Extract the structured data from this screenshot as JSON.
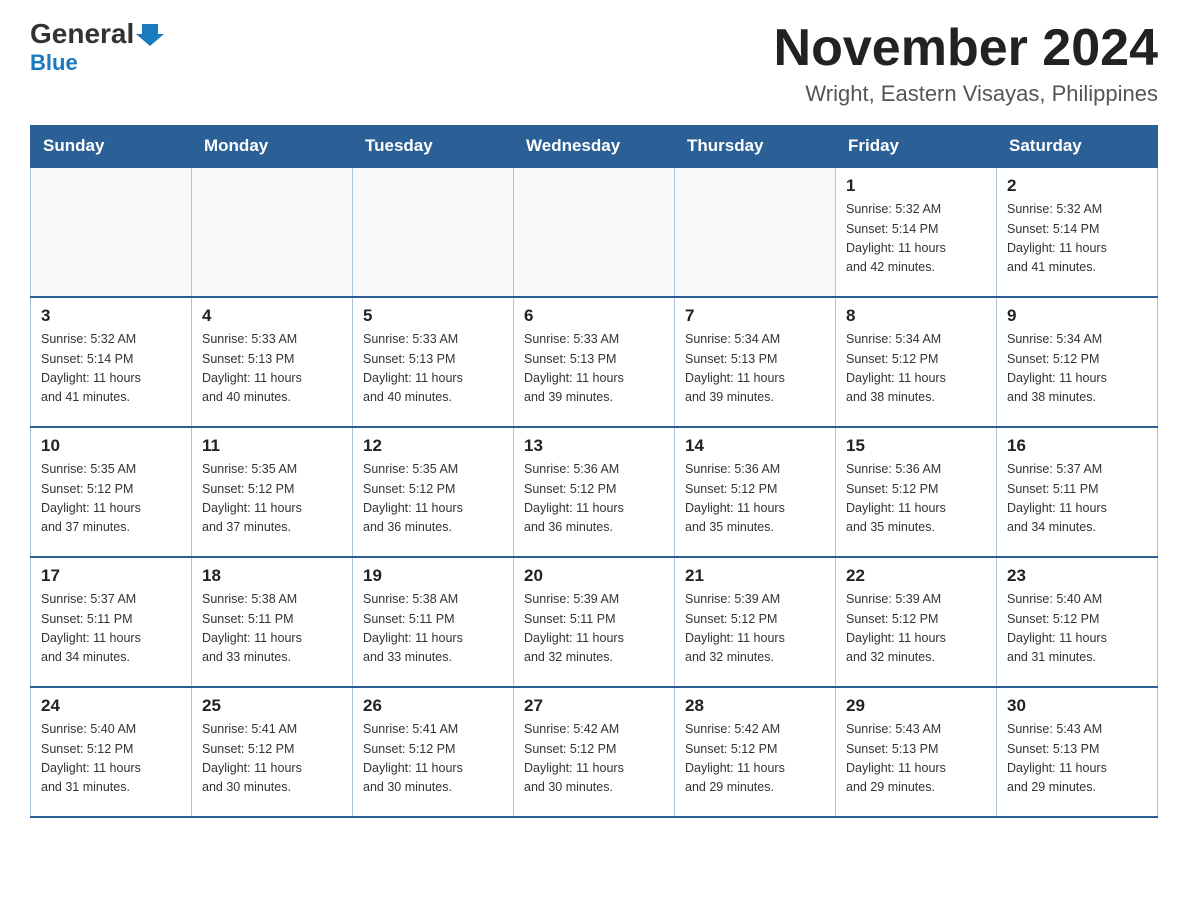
{
  "logo": {
    "general": "General",
    "blue": "Blue"
  },
  "title": "November 2024",
  "location": "Wright, Eastern Visayas, Philippines",
  "days_header": [
    "Sunday",
    "Monday",
    "Tuesday",
    "Wednesday",
    "Thursday",
    "Friday",
    "Saturday"
  ],
  "weeks": [
    [
      {
        "day": "",
        "info": ""
      },
      {
        "day": "",
        "info": ""
      },
      {
        "day": "",
        "info": ""
      },
      {
        "day": "",
        "info": ""
      },
      {
        "day": "",
        "info": ""
      },
      {
        "day": "1",
        "info": "Sunrise: 5:32 AM\nSunset: 5:14 PM\nDaylight: 11 hours\nand 42 minutes."
      },
      {
        "day": "2",
        "info": "Sunrise: 5:32 AM\nSunset: 5:14 PM\nDaylight: 11 hours\nand 41 minutes."
      }
    ],
    [
      {
        "day": "3",
        "info": "Sunrise: 5:32 AM\nSunset: 5:14 PM\nDaylight: 11 hours\nand 41 minutes."
      },
      {
        "day": "4",
        "info": "Sunrise: 5:33 AM\nSunset: 5:13 PM\nDaylight: 11 hours\nand 40 minutes."
      },
      {
        "day": "5",
        "info": "Sunrise: 5:33 AM\nSunset: 5:13 PM\nDaylight: 11 hours\nand 40 minutes."
      },
      {
        "day": "6",
        "info": "Sunrise: 5:33 AM\nSunset: 5:13 PM\nDaylight: 11 hours\nand 39 minutes."
      },
      {
        "day": "7",
        "info": "Sunrise: 5:34 AM\nSunset: 5:13 PM\nDaylight: 11 hours\nand 39 minutes."
      },
      {
        "day": "8",
        "info": "Sunrise: 5:34 AM\nSunset: 5:12 PM\nDaylight: 11 hours\nand 38 minutes."
      },
      {
        "day": "9",
        "info": "Sunrise: 5:34 AM\nSunset: 5:12 PM\nDaylight: 11 hours\nand 38 minutes."
      }
    ],
    [
      {
        "day": "10",
        "info": "Sunrise: 5:35 AM\nSunset: 5:12 PM\nDaylight: 11 hours\nand 37 minutes."
      },
      {
        "day": "11",
        "info": "Sunrise: 5:35 AM\nSunset: 5:12 PM\nDaylight: 11 hours\nand 37 minutes."
      },
      {
        "day": "12",
        "info": "Sunrise: 5:35 AM\nSunset: 5:12 PM\nDaylight: 11 hours\nand 36 minutes."
      },
      {
        "day": "13",
        "info": "Sunrise: 5:36 AM\nSunset: 5:12 PM\nDaylight: 11 hours\nand 36 minutes."
      },
      {
        "day": "14",
        "info": "Sunrise: 5:36 AM\nSunset: 5:12 PM\nDaylight: 11 hours\nand 35 minutes."
      },
      {
        "day": "15",
        "info": "Sunrise: 5:36 AM\nSunset: 5:12 PM\nDaylight: 11 hours\nand 35 minutes."
      },
      {
        "day": "16",
        "info": "Sunrise: 5:37 AM\nSunset: 5:11 PM\nDaylight: 11 hours\nand 34 minutes."
      }
    ],
    [
      {
        "day": "17",
        "info": "Sunrise: 5:37 AM\nSunset: 5:11 PM\nDaylight: 11 hours\nand 34 minutes."
      },
      {
        "day": "18",
        "info": "Sunrise: 5:38 AM\nSunset: 5:11 PM\nDaylight: 11 hours\nand 33 minutes."
      },
      {
        "day": "19",
        "info": "Sunrise: 5:38 AM\nSunset: 5:11 PM\nDaylight: 11 hours\nand 33 minutes."
      },
      {
        "day": "20",
        "info": "Sunrise: 5:39 AM\nSunset: 5:11 PM\nDaylight: 11 hours\nand 32 minutes."
      },
      {
        "day": "21",
        "info": "Sunrise: 5:39 AM\nSunset: 5:12 PM\nDaylight: 11 hours\nand 32 minutes."
      },
      {
        "day": "22",
        "info": "Sunrise: 5:39 AM\nSunset: 5:12 PM\nDaylight: 11 hours\nand 32 minutes."
      },
      {
        "day": "23",
        "info": "Sunrise: 5:40 AM\nSunset: 5:12 PM\nDaylight: 11 hours\nand 31 minutes."
      }
    ],
    [
      {
        "day": "24",
        "info": "Sunrise: 5:40 AM\nSunset: 5:12 PM\nDaylight: 11 hours\nand 31 minutes."
      },
      {
        "day": "25",
        "info": "Sunrise: 5:41 AM\nSunset: 5:12 PM\nDaylight: 11 hours\nand 30 minutes."
      },
      {
        "day": "26",
        "info": "Sunrise: 5:41 AM\nSunset: 5:12 PM\nDaylight: 11 hours\nand 30 minutes."
      },
      {
        "day": "27",
        "info": "Sunrise: 5:42 AM\nSunset: 5:12 PM\nDaylight: 11 hours\nand 30 minutes."
      },
      {
        "day": "28",
        "info": "Sunrise: 5:42 AM\nSunset: 5:12 PM\nDaylight: 11 hours\nand 29 minutes."
      },
      {
        "day": "29",
        "info": "Sunrise: 5:43 AM\nSunset: 5:13 PM\nDaylight: 11 hours\nand 29 minutes."
      },
      {
        "day": "30",
        "info": "Sunrise: 5:43 AM\nSunset: 5:13 PM\nDaylight: 11 hours\nand 29 minutes."
      }
    ]
  ]
}
